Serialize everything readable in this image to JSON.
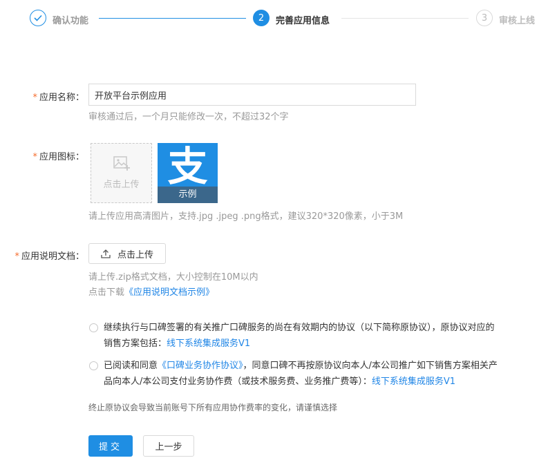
{
  "steps": [
    {
      "number": "✓",
      "label": "确认功能",
      "state": "done"
    },
    {
      "number": "2",
      "label": "完善应用信息",
      "state": "active"
    },
    {
      "number": "3",
      "label": "审核上线",
      "state": "pending"
    }
  ],
  "colors": {
    "accent": "#1f8ee3",
    "link": "#1f85e6",
    "required": "#f56c2d",
    "muted": "#999999"
  },
  "form": {
    "required_mark": "*",
    "app_name": {
      "label": "应用名称：",
      "value": "开放平台示例应用",
      "hint": "审核通过后，一个月只能修改一次，不超过32个字"
    },
    "app_icon": {
      "label": "应用图标：",
      "upload_text": "点击上传",
      "sample_caption": "示例",
      "sample_glyph": "支",
      "hint": "请上传应用高清图片，支持.jpg .jpeg .png格式，建议320*320像素，小于3M"
    },
    "app_doc": {
      "label": "应用说明文档：",
      "upload_button": "点击上传",
      "hint": "请上传.zip格式文档，大小控制在10M以内",
      "download_prefix": "点击下载",
      "download_link": "《应用说明文档示例》"
    }
  },
  "options": [
    {
      "line1": "继续执行与口碑签署的有关推广口碑服务的尚在有效期内的协议（以下简称原协议），原协议对应的",
      "line2_prefix": "销售方案包括：",
      "line2_link": "线下系统集成服务V1"
    },
    {
      "line1_prefix": "已阅读和同意",
      "line1_link": "《口碑业务协作协议》",
      "line1_suffix": "，同意口碑不再按原协议向本人/本公司推广如下销售方案相关产",
      "line2_prefix": "品向本人/本公司支付业务协作费（或技术服务费、业务推广费等）：",
      "line2_link": "线下系统集成服务V1"
    }
  ],
  "warning": "终止原协议会导致当前账号下所有应用协作费率的变化，请谨慎选择",
  "buttons": {
    "submit": "提交",
    "back": "上一步"
  }
}
